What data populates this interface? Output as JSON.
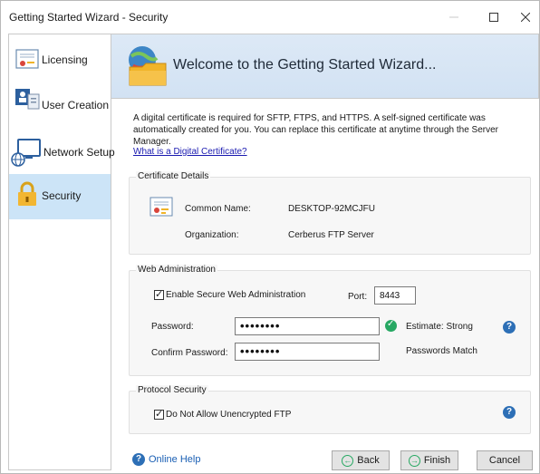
{
  "window": {
    "title": "Getting Started Wizard - Security",
    "controls": [
      "minimize",
      "maximize",
      "close"
    ]
  },
  "sidebar": {
    "items": [
      {
        "label": "Licensing",
        "icon": "certificate-icon",
        "active": false
      },
      {
        "label": "User Creation",
        "icon": "users-icon",
        "active": false
      },
      {
        "label": "Network Setup",
        "icon": "network-icon",
        "active": false
      },
      {
        "label": "Security",
        "icon": "lock-icon",
        "active": true
      }
    ]
  },
  "header": {
    "headline": "Welcome to the Getting Started Wizard..."
  },
  "intro": {
    "text": "A digital certificate is required for SFTP, FTPS, and HTTPS.  A self-signed certificate was automatically created for you.  You can replace this certificate at anytime through the Server Manager.",
    "link": "What is a Digital Certificate?"
  },
  "certificate": {
    "group_title": "Certificate Details",
    "common_name_label": "Common Name:",
    "common_name": "DESKTOP-92MCJFU",
    "organization_label": "Organization:",
    "organization": "Cerberus FTP Server"
  },
  "web_admin": {
    "group_title": "Web Administration",
    "enable_label": "Enable Secure Web Administration",
    "enable_checked": true,
    "port_label": "Port:",
    "port": "8443",
    "password_label": "Password:",
    "password_value": "••••••••",
    "estimate": "Estimate: Strong",
    "confirm_label": "Confirm Password:",
    "confirm_value": "••••••••",
    "match": "Passwords Match"
  },
  "protocol": {
    "group_title": "Protocol Security",
    "disallow_label": "Do Not Allow Unencrypted FTP",
    "disallow_checked": true
  },
  "footer": {
    "help_label": "Online Help",
    "back_label": "Back",
    "finish_label": "Finish",
    "cancel_label": "Cancel"
  },
  "colors": {
    "accent": "#2d6fb6",
    "sidebar_active": "#cce4f7",
    "header_bg": "#d6e4f4",
    "ok_green": "#27a863"
  }
}
